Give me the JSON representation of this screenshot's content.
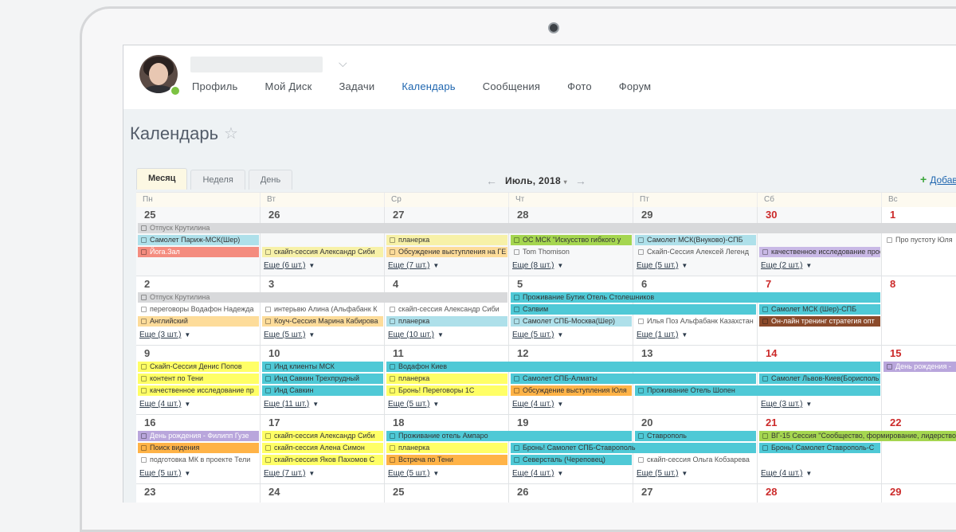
{
  "nav": [
    "Профиль",
    "Мой Диск",
    "Задачи",
    "Календарь",
    "Сообщения",
    "Фото",
    "Форум"
  ],
  "nav_active": 3,
  "page_title": "Календарь",
  "tabs": [
    "Месяц",
    "Неделя",
    "День"
  ],
  "month": "Июль, 2018",
  "add_label": "Добав",
  "days": [
    "Пн",
    "Вт",
    "Ср",
    "Чт",
    "Пт",
    "Сб",
    "Вс"
  ],
  "weeks": [
    {
      "nums": [
        "25",
        "26",
        "27",
        "28",
        "29",
        "30",
        "1"
      ],
      "red": [
        5,
        6
      ],
      "other": [
        0,
        1,
        2,
        3,
        4,
        5
      ],
      "events": [
        {
          "col": 0,
          "span": 7,
          "row": 0,
          "text": "Отпуск Крутилина",
          "color": "gray"
        },
        {
          "col": 0,
          "span": 1,
          "row": 1,
          "text": "Самолет Париж-МСК(Шер)",
          "color": "lblue"
        },
        {
          "col": 2,
          "span": 1,
          "row": 1,
          "text": "планерка",
          "color": "lyellow"
        },
        {
          "col": 3,
          "span": 1,
          "row": 1,
          "text": "ОС МСК \"Искусство гибкого у",
          "color": "green"
        },
        {
          "col": 4,
          "span": 1,
          "row": 1,
          "text": "Самолет МСК(Внуково)-СПБ",
          "color": "lblue"
        },
        {
          "col": 6,
          "span": 1,
          "row": 1,
          "text": "Про пустоту Юля",
          "color": "white"
        },
        {
          "col": 0,
          "span": 1,
          "row": 2,
          "text": "Йога.Зал",
          "color": "salmon"
        },
        {
          "col": 1,
          "span": 1,
          "row": 2,
          "text": "скайп-сессия Александр Сиби",
          "color": "lyellow"
        },
        {
          "col": 2,
          "span": 1,
          "row": 2,
          "text": "Обсуждение выступления на ГЕ",
          "color": "lorange"
        },
        {
          "col": 3,
          "span": 1,
          "row": 2,
          "text": "Tom Thomison",
          "color": "white"
        },
        {
          "col": 4,
          "span": 1,
          "row": 2,
          "text": "Скайп-Сессия Алексей Легенд",
          "color": "white"
        },
        {
          "col": 5,
          "span": 1,
          "row": 2,
          "text": "качественное исследование проек",
          "color": "lpurple"
        }
      ],
      "more": [
        {
          "col": 1,
          "text": "Еще (6 шт.)"
        },
        {
          "col": 2,
          "text": "Еще (7 шт.)"
        },
        {
          "col": 3,
          "text": "Еще (8 шт.)"
        },
        {
          "col": 4,
          "text": "Еще (5 шт.)"
        },
        {
          "col": 5,
          "text": "Еще (2 шт.)"
        }
      ]
    },
    {
      "nums": [
        "2",
        "3",
        "4",
        "5",
        "6",
        "7",
        "8"
      ],
      "red": [
        5,
        6
      ],
      "other": [],
      "events": [
        {
          "col": 0,
          "span": 3,
          "row": 0,
          "text": "Отпуск Крутилина",
          "color": "gray"
        },
        {
          "col": 3,
          "span": 3,
          "row": 0,
          "text": "Проживание Бутик Отель Столешников",
          "color": "teal"
        },
        {
          "col": 0,
          "span": 1,
          "row": 1,
          "text": "переговоры Водафон Надежда",
          "color": "white"
        },
        {
          "col": 1,
          "span": 1,
          "row": 1,
          "text": "интерьвю Алина (Альфабанк К",
          "color": "white"
        },
        {
          "col": 2,
          "span": 1,
          "row": 1,
          "text": "скайп-сессия Александр Сиби",
          "color": "white"
        },
        {
          "col": 3,
          "span": 2,
          "row": 1,
          "text": "Сэлвим",
          "color": "teal"
        },
        {
          "col": 5,
          "span": 1,
          "row": 1,
          "text": "Самолет МСК (Шер)-СПБ",
          "color": "teal"
        },
        {
          "col": 0,
          "span": 1,
          "row": 2,
          "text": "Английский",
          "color": "lorange"
        },
        {
          "col": 1,
          "span": 1,
          "row": 2,
          "text": "Коуч-Сессия Марина Кабирова",
          "color": "lorange"
        },
        {
          "col": 2,
          "span": 1,
          "row": 2,
          "text": "планерка",
          "color": "lblue"
        },
        {
          "col": 3,
          "span": 1,
          "row": 2,
          "text": "Самолет СПБ-Москва(Шер)",
          "color": "lblue"
        },
        {
          "col": 4,
          "span": 1,
          "row": 2,
          "text": "Илья Поз Альфабанк Казахстан",
          "color": "white"
        },
        {
          "col": 5,
          "span": 1,
          "row": 2,
          "text": "Он-лайн тренинг стратегия опт",
          "color": "dbrown"
        }
      ],
      "more": [
        {
          "col": 0,
          "text": "Еще (3 шт.)"
        },
        {
          "col": 1,
          "text": "Еще (5 шт.)"
        },
        {
          "col": 2,
          "text": "Еще (10 шт.)"
        },
        {
          "col": 3,
          "text": "Еще (5 шт.)"
        },
        {
          "col": 4,
          "text": "Еще (1 шт.)"
        }
      ]
    },
    {
      "nums": [
        "9",
        "10",
        "11",
        "12",
        "13",
        "14",
        "15"
      ],
      "red": [
        5,
        6
      ],
      "other": [],
      "events": [
        {
          "col": 0,
          "span": 1,
          "row": 0,
          "text": "Скайп-Сессия Денис Попов",
          "color": "yellow"
        },
        {
          "col": 1,
          "span": 1,
          "row": 0,
          "text": "Инд клиенты МСК",
          "color": "teal"
        },
        {
          "col": 2,
          "span": 4,
          "row": 0,
          "text": "Водафон Киев",
          "color": "teal"
        },
        {
          "col": 6,
          "span": 1,
          "row": 0,
          "text": "День рождения - ",
          "color": "purple"
        },
        {
          "col": 0,
          "span": 1,
          "row": 1,
          "text": "контент по Тени",
          "color": "yellow"
        },
        {
          "col": 1,
          "span": 1,
          "row": 1,
          "text": "Инд Савкин Трехпрудный",
          "color": "teal"
        },
        {
          "col": 2,
          "span": 1,
          "row": 1,
          "text": "планерка",
          "color": "yellow"
        },
        {
          "col": 3,
          "span": 2,
          "row": 1,
          "text": "Самолет СПБ-Алматы",
          "color": "teal"
        },
        {
          "col": 5,
          "span": 1,
          "row": 1,
          "text": "Самолет Львов-Киев(Борисполь",
          "color": "teal"
        },
        {
          "col": 0,
          "span": 1,
          "row": 2,
          "text": "качественное исследование пр",
          "color": "yellow"
        },
        {
          "col": 1,
          "span": 1,
          "row": 2,
          "text": "Инд Савкин",
          "color": "teal"
        },
        {
          "col": 2,
          "span": 1,
          "row": 2,
          "text": "Бронь! Переговоры 1С",
          "color": "yellow"
        },
        {
          "col": 3,
          "span": 1,
          "row": 2,
          "text": "Обсуждение выступления Юля",
          "color": "orange"
        },
        {
          "col": 4,
          "span": 2,
          "row": 2,
          "text": "Проживание Отель Шопен",
          "color": "teal"
        }
      ],
      "more": [
        {
          "col": 0,
          "text": "Еще (4 шт.)"
        },
        {
          "col": 1,
          "text": "Еще (11 шт.)"
        },
        {
          "col": 2,
          "text": "Еще (5 шт.)"
        },
        {
          "col": 3,
          "text": "Еще (4 шт.)"
        },
        {
          "col": 5,
          "text": "Еще (3 шт.)"
        }
      ]
    },
    {
      "nums": [
        "16",
        "17",
        "18",
        "19",
        "20",
        "21",
        "22"
      ],
      "red": [
        5,
        6
      ],
      "other": [],
      "events": [
        {
          "col": 0,
          "span": 1,
          "row": 0,
          "text": "День рождения - Филипп Гузе",
          "color": "purple"
        },
        {
          "col": 1,
          "span": 1,
          "row": 0,
          "text": "скайп-сессия Александр Сиби",
          "color": "yellow"
        },
        {
          "col": 2,
          "span": 2,
          "row": 0,
          "text": "Проживание отель Ампаро",
          "color": "teal"
        },
        {
          "col": 4,
          "span": 1,
          "row": 0,
          "text": "Ставрополь",
          "color": "teal"
        },
        {
          "col": 5,
          "span": 2,
          "row": 0,
          "text": "ВГ-15 Сессия \"Сообщество, формирование, лидерство",
          "color": "green"
        },
        {
          "col": 0,
          "span": 1,
          "row": 1,
          "text": "Поиск видения",
          "color": "orange"
        },
        {
          "col": 1,
          "span": 1,
          "row": 1,
          "text": "скайп-сессия Алена Симон",
          "color": "yellow"
        },
        {
          "col": 2,
          "span": 1,
          "row": 1,
          "text": "планерка",
          "color": "yellow"
        },
        {
          "col": 3,
          "span": 2,
          "row": 1,
          "text": "Бронь! Самолет СПБ-Ставрополь",
          "color": "teal"
        },
        {
          "col": 5,
          "span": 1,
          "row": 1,
          "text": "Бронь! Самолет Ставрополь-С",
          "color": "teal"
        },
        {
          "col": 0,
          "span": 1,
          "row": 2,
          "text": "подготовка МК в проекте Тели",
          "color": "white"
        },
        {
          "col": 1,
          "span": 1,
          "row": 2,
          "text": "скайп-сессия Яков Пахомов С",
          "color": "yellow"
        },
        {
          "col": 2,
          "span": 1,
          "row": 2,
          "text": "Встреча по Тени",
          "color": "orange"
        },
        {
          "col": 3,
          "span": 1,
          "row": 2,
          "text": "Северсталь (Череповец)",
          "color": "teal"
        },
        {
          "col": 4,
          "span": 1,
          "row": 2,
          "text": "скайп-сессия Ольга Кобзарева",
          "color": "white"
        }
      ],
      "more": [
        {
          "col": 0,
          "text": "Еще (5 шт.)"
        },
        {
          "col": 1,
          "text": "Еще (7 шт.)"
        },
        {
          "col": 2,
          "text": "Еще (5 шт.)"
        },
        {
          "col": 3,
          "text": "Еще (4 шт.)"
        },
        {
          "col": 4,
          "text": "Еще (5 шт.)"
        },
        {
          "col": 5,
          "text": "Еще (4 шт.)"
        }
      ]
    },
    {
      "nums": [
        "23",
        "24",
        "25",
        "26",
        "27",
        "28",
        "29"
      ],
      "red": [
        5,
        6
      ],
      "other": [],
      "events": [],
      "more": []
    }
  ],
  "colors": {
    "nav_active": "#2067b0",
    "weekend": "#cc2a2a"
  }
}
